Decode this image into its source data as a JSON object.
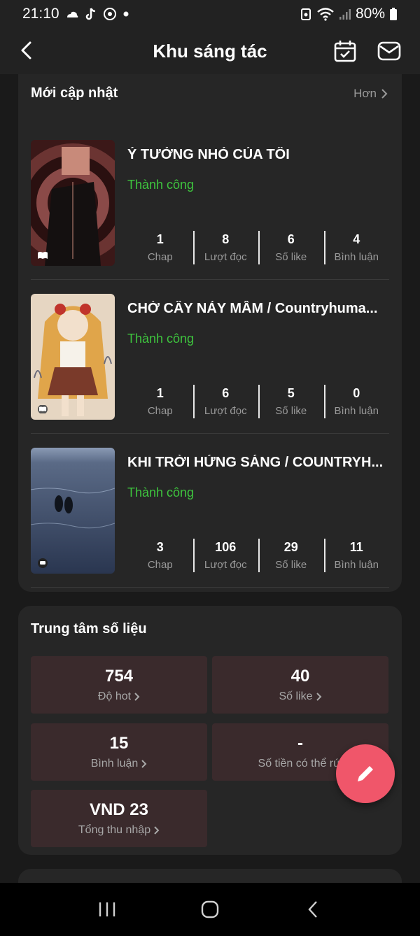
{
  "status_bar": {
    "time": "21:10",
    "battery": "80%"
  },
  "header": {
    "title": "Khu sáng tác",
    "icons": [
      "back-arrow-icon",
      "calendar-check-icon",
      "mail-icon"
    ]
  },
  "updates": {
    "section_title": "Mới cập nhật",
    "more_label": "Hơn",
    "works": [
      {
        "title": "Ý TƯỞNG NHỎ CỦA TÔI",
        "status": "Thành công",
        "badge_icon": "book-icon",
        "stats": [
          {
            "value": "1",
            "label": "Chap"
          },
          {
            "value": "8",
            "label": "Lượt đọc"
          },
          {
            "value": "6",
            "label": "Số like"
          },
          {
            "value": "4",
            "label": "Bình luận"
          }
        ]
      },
      {
        "title": "CHỜ CÂY NẢY MẦM / Countryhuma...",
        "status": "Thành công",
        "badge_icon": "book-icon",
        "stats": [
          {
            "value": "1",
            "label": "Chap"
          },
          {
            "value": "6",
            "label": "Lượt đọc"
          },
          {
            "value": "5",
            "label": "Số like"
          },
          {
            "value": "0",
            "label": "Bình luận"
          }
        ]
      },
      {
        "title": "KHI TRỜI HỬNG SÁNG / COUNTRYH...",
        "status": "Thành công",
        "badge_icon": "chat-bubble-icon",
        "stats": [
          {
            "value": "3",
            "label": "Chap"
          },
          {
            "value": "106",
            "label": "Lượt đọc"
          },
          {
            "value": "29",
            "label": "Số like"
          },
          {
            "value": "11",
            "label": "Bình luận"
          }
        ]
      }
    ]
  },
  "data_center": {
    "section_title": "Trung tâm số liệu",
    "tiles": [
      {
        "value": "754",
        "label": "Độ hot"
      },
      {
        "value": "40",
        "label": "Số like"
      },
      {
        "value": "15",
        "label": "Bình luận"
      },
      {
        "value": "-",
        "label": "Số tiền có thể rút"
      },
      {
        "value": "VND 23",
        "label": "Tổng thu nhập"
      }
    ]
  },
  "fab": {
    "icon": "pencil-icon"
  },
  "nav": {
    "icons": [
      "recents-icon",
      "home-icon",
      "back-icon"
    ]
  },
  "colors": {
    "accent_green": "#3ec43e",
    "fab_pink": "#f0566a",
    "tile_bg": "#3a2a2c",
    "card_bg": "#262626"
  }
}
